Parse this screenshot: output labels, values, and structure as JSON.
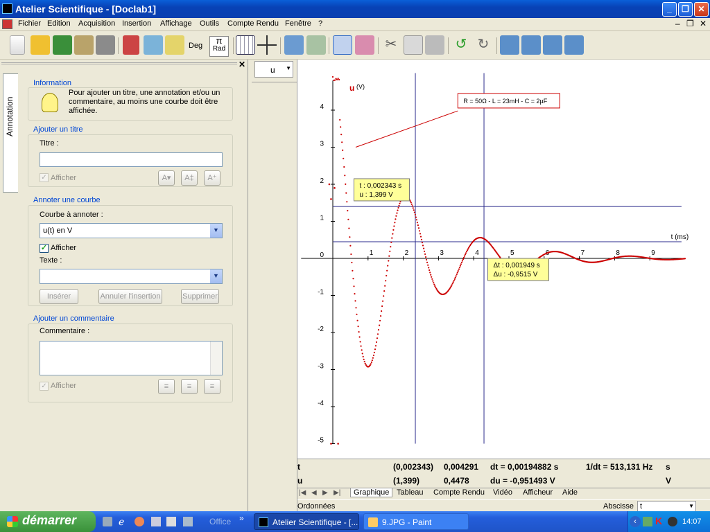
{
  "window": {
    "title": "Atelier Scientifique - [Doclab1]"
  },
  "menu": [
    "Fichier",
    "Edition",
    "Acquisition",
    "Insertion",
    "Affichage",
    "Outils",
    "Compte Rendu",
    "Fenêtre",
    "?"
  ],
  "toolbar": {
    "deg_label": "Deg",
    "rad_label": "Rad"
  },
  "panel": {
    "tab_label": "Annotation",
    "info": {
      "title": "Information",
      "text": "Pour ajouter un titre, une annotation et/ou un commentaire, au moins une courbe doit être affichée."
    },
    "title_group": {
      "title": "Ajouter un titre",
      "field_label": "Titre :",
      "field_value": "",
      "show_label": "Afficher",
      "show_checked": true,
      "show_disabled": true
    },
    "annotate_group": {
      "title": "Annoter une courbe",
      "curve_label": "Courbe à annoter :",
      "curve_value": "u(t) en V",
      "show_label": "Afficher",
      "show_checked": true,
      "text_label": "Texte :",
      "text_value": "",
      "insert_label": "Insérer",
      "cancel_label": "Annuler l'insertion",
      "delete_label": "Supprimer"
    },
    "comment_group": {
      "title": "Ajouter un commentaire",
      "comment_label": "Commentaire :",
      "show_label": "Afficher",
      "show_checked": true,
      "show_disabled": true
    }
  },
  "ordinate_select": "u",
  "chart_data": {
    "type": "scatter",
    "ylabel": "u",
    "yunit": "(V)",
    "xlabel": "t (ms)",
    "xlim": [
      -0.9,
      9.9
    ],
    "ylim": [
      -5,
      5
    ],
    "xticks": [
      1,
      2,
      3,
      4,
      5,
      6,
      7,
      8,
      9
    ],
    "yticks": [
      -5,
      -4,
      -3,
      -2,
      -1,
      0,
      1,
      2,
      3,
      4
    ],
    "series": [
      {
        "model": {
          "amplitude": 5.0,
          "decay_per_ms": 0.52,
          "period_ms": 2.12
        },
        "t_range": [
          0,
          10
        ]
      }
    ],
    "annotation": "R = 50Ω - L = 23mH - C = 2µF",
    "cursor1": {
      "t": 2.343,
      "u": 1.399,
      "label_t": "t : 0,002343 s",
      "label_u": "u : 1,399 V"
    },
    "cursor2": {
      "t": 4.292,
      "u": 0.4478,
      "label_dt": "Δt : 0,001949 s",
      "label_du": "Δu : -0,9515 V"
    },
    "stray_points": [
      {
        "t": -0.05,
        "u": -5
      },
      {
        "t": 0.15,
        "u": -5
      },
      {
        "t": -0.1,
        "u": 2.0
      },
      {
        "t": 0.05,
        "u": 1.9
      },
      {
        "t": -0.05,
        "u": 1.6
      }
    ]
  },
  "status": {
    "row1": {
      "var": "t",
      "paren": "(0,002343)",
      "value": "0,004291",
      "delta": "dt = 0,00194882 s",
      "inv": "1/dt = 513,131 Hz",
      "unit": "s"
    },
    "row2": {
      "var": "u",
      "paren": "(1,399)",
      "value": "0,4478",
      "delta": "du = -0,951493 V",
      "inv": "",
      "unit": "V"
    }
  },
  "tabs": [
    "Graphique",
    "Tableau",
    "Compte Rendu",
    "Vidéo",
    "Afficheur",
    "Aide"
  ],
  "bottom": {
    "left": "Ordonnées",
    "abscisse_label": "Abscisse",
    "abscisse_value": "t"
  },
  "taskbar": {
    "start": "démarrer",
    "office": "Office",
    "tasks": [
      "Atelier Scientifique - [...",
      "9.JPG - Paint"
    ],
    "clock": "14:07"
  }
}
